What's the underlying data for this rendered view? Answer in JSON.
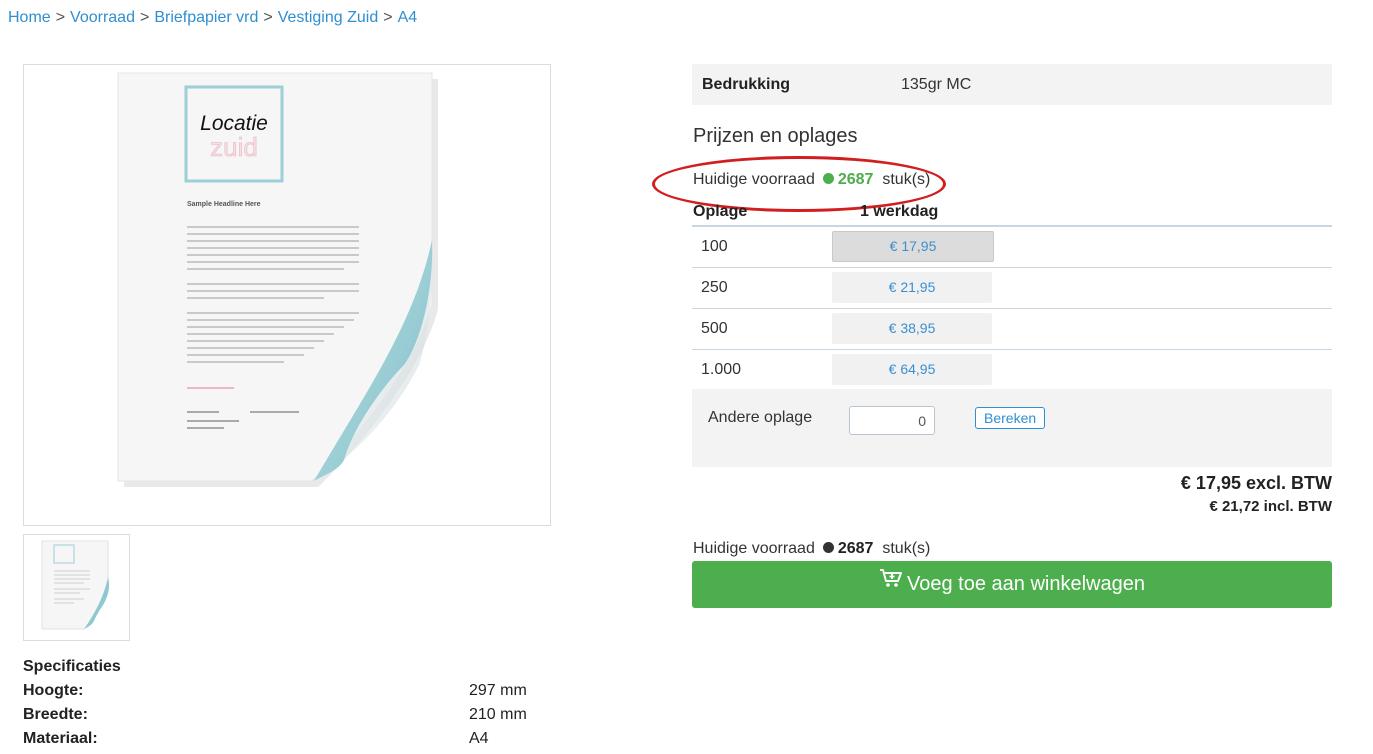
{
  "breadcrumb": [
    "Home",
    "Voorraad",
    "Briefpapier vrd",
    "Vestiging Zuid",
    "A4"
  ],
  "breadcrumb_separator": ">",
  "product_image": {
    "logo_line1": "Locatie",
    "logo_line2": "zuid",
    "headline": "Sample Headline Here"
  },
  "specs": {
    "title": "Specificaties",
    "rows": [
      {
        "label": "Hoogte:",
        "value": "297 mm"
      },
      {
        "label": "Breedte:",
        "value": "210 mm"
      },
      {
        "label": "Materiaal:",
        "value": "A4"
      }
    ]
  },
  "bedrukking": {
    "label": "Bedrukking",
    "value": "135gr MC"
  },
  "section_title": "Prijzen en oplages",
  "stock": {
    "label": "Huidige voorraad",
    "count": "2687",
    "unit": "stuk(s)"
  },
  "price_table": {
    "headers": [
      "Oplage",
      "1 werkdag"
    ],
    "rows": [
      {
        "qty": "100",
        "price": "€ 17,95",
        "selected": true
      },
      {
        "qty": "250",
        "price": "€ 21,95",
        "selected": false
      },
      {
        "qty": "500",
        "price": "€ 38,95",
        "selected": false
      },
      {
        "qty": "1.000",
        "price": "€ 64,95",
        "selected": false
      }
    ]
  },
  "other_quantity": {
    "label": "Andere oplage",
    "value": "0",
    "button": "Bereken"
  },
  "total": {
    "excl": "€ 17,95 excl. BTW",
    "incl": "€ 21,72 incl. BTW"
  },
  "stock_bottom": {
    "label": "Huidige voorraad",
    "count": "2687",
    "unit": "stuk(s)"
  },
  "cart_button": {
    "label": "Voeg toe aan winkelwagen",
    "icon": "cart-plus-icon"
  },
  "colors": {
    "link": "#2f8fd0",
    "green": "#4cae4c",
    "highlight": "#d11f1f"
  }
}
